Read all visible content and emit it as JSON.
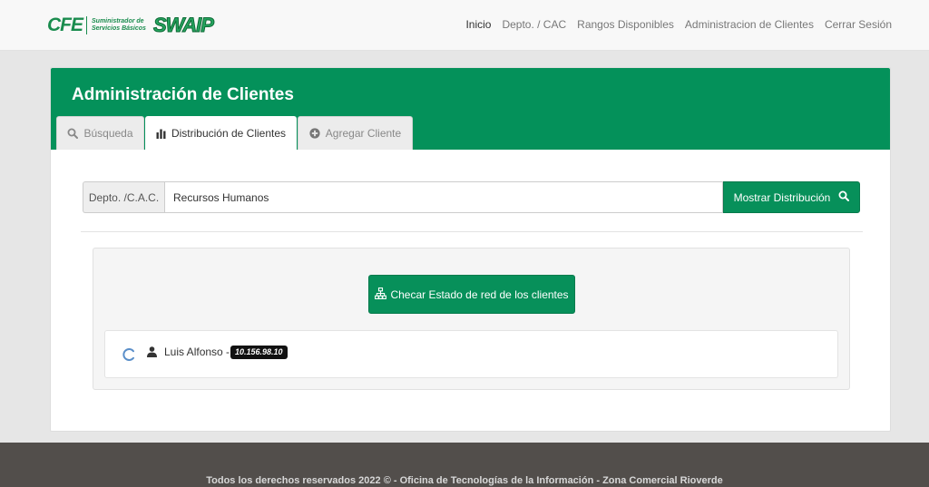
{
  "brand": {
    "cfe": "CFE",
    "subtitle_line1": "Suministrador de",
    "subtitle_line2": "Servicios Básicos",
    "app": "SWAIP"
  },
  "nav": {
    "items": [
      {
        "label": "Inicio",
        "active": true
      },
      {
        "label": "Depto. / CAC"
      },
      {
        "label": "Rangos Disponibles"
      },
      {
        "label": "Administracion de Clientes"
      },
      {
        "label": "Cerrar Sesión"
      }
    ]
  },
  "panel": {
    "title": "Administración de Clientes",
    "tabs": [
      {
        "label": "Búsqueda",
        "icon": "search-icon"
      },
      {
        "label": "Distribución de Clientes",
        "icon": "bar-chart-icon",
        "active": true
      },
      {
        "label": "Agregar Cliente",
        "icon": "plus-circle-icon"
      }
    ]
  },
  "search": {
    "addon_label": "Depto. /C.A.C.",
    "value": "Recursos Humanos",
    "button_label": "Mostrar Distribución"
  },
  "distribution": {
    "check_button_label": "Checar Estado de red de los clientes",
    "clients": [
      {
        "name": "Luis Alfonso -",
        "ip": "10.156.98.10",
        "status_icon": "spinner-icon"
      }
    ]
  },
  "footer": {
    "text": "Todos los derechos reservados 2022 © - Oficina de Tecnologías de la Información - Zona Comercial Rioverde"
  },
  "colors": {
    "primary": "#04915a",
    "button": "#07905a",
    "footer": "#524e4b"
  }
}
